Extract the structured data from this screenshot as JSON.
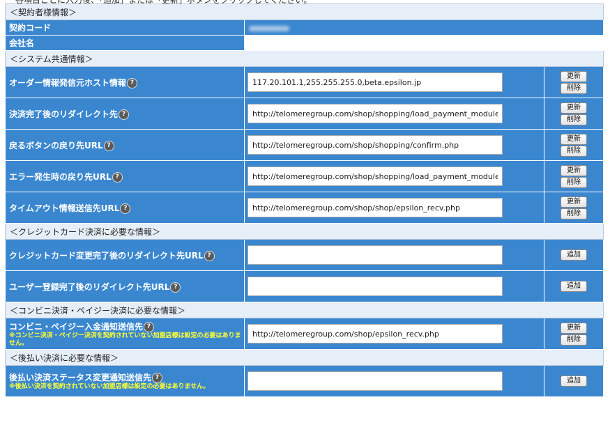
{
  "header": {
    "instruction": "各項目ごとに入力後、「追加」または「更新」ボタンをクリックしてください。"
  },
  "sections": {
    "contract": "＜契約者様情報＞",
    "system": "＜システム共通情報＞",
    "credit": "＜クレジットカード決済に必要な情報＞",
    "conveni": "＜コンビニ決済・ペイジー決済に必要な情報＞",
    "deferred": "＜後払い決済に必要な情報＞"
  },
  "contract": {
    "code_label": "契約コード",
    "company_label": "会社名"
  },
  "buttons": {
    "update": "更新",
    "delete": "削除",
    "add": "追加"
  },
  "help_glyph": "?",
  "fields": {
    "order_host": {
      "label": "オーダー情報発信元ホスト情報",
      "value": "117.20.101.1,255.255.255.0,beta.epsilon.jp"
    },
    "redirect_after_payment": {
      "label": "決済完了後のリダイレクト先",
      "value": "http://telomeregroup.com/shop/shopping/load_payment_module.php"
    },
    "back_button_url": {
      "label": "戻るボタンの戻り先URL",
      "value": "http://telomeregroup.com/shop/shopping/confirm.php"
    },
    "error_return_url": {
      "label": "エラー発生時の戻り先URL",
      "value": "http://telomeregroup.com/shop/shopping/load_payment_module.php"
    },
    "timeout_url": {
      "label": "タイムアウト情報送信先URL",
      "value": "http://telomeregroup.com/shop/shop/epsilon_recv.php"
    },
    "card_change_redirect": {
      "label": "クレジットカード変更完了後のリダイレクト先URL",
      "value": ""
    },
    "user_reg_redirect": {
      "label": "ユーザー登録完了後のリダイレクト先URL",
      "value": ""
    },
    "conveni_notify": {
      "label": "コンビニ・ペイジー入金通知送信先",
      "note": "※コンビニ決済・ペイジー決済を契約されていない加盟店様は設定の必要はありません。",
      "value": "http://telomeregroup.com/shop/epsilon_recv.php"
    },
    "deferred_notify": {
      "label": "後払い決済ステータス変更通知送信先",
      "note": "※後払い決済を契約されていない加盟店様は設定の必要はありません。",
      "value": ""
    }
  }
}
